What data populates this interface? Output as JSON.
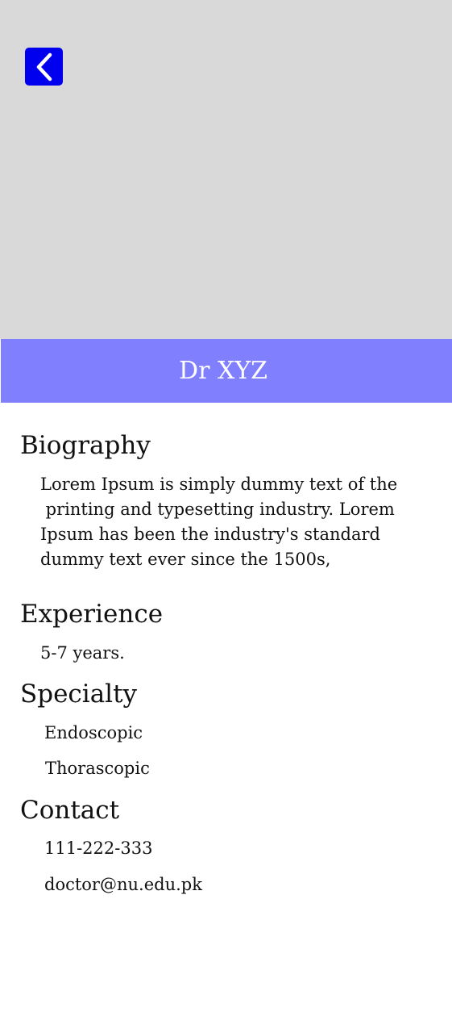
{
  "header": {
    "back_icon": "chevron-left-icon",
    "doctor_name": "Dr XYZ"
  },
  "colors": {
    "hero_background": "#d9d9d9",
    "back_button": "#0000ee",
    "name_bar": "#8080ff",
    "name_text": "#ffffff"
  },
  "biography": {
    "heading": "Biography",
    "lines": [
      "Lorem Ipsum is simply dummy text of the",
      " printing and typesetting industry. Lorem",
      "Ipsum has been the industry's standard",
      "dummy text ever since the 1500s,"
    ]
  },
  "experience": {
    "heading": "Experience",
    "value": "5-7 years."
  },
  "specialty": {
    "heading": "Specialty",
    "items": [
      "Endoscopic",
      "Thorascopic"
    ]
  },
  "contact": {
    "heading": "Contact",
    "phone": "111-222-333",
    "email": "doctor@nu.edu.pk"
  }
}
